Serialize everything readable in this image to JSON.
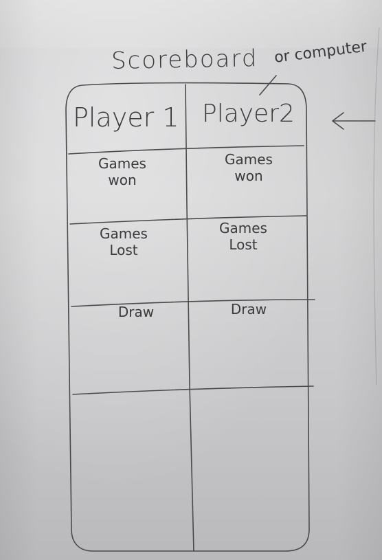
{
  "title": "Scoreboard",
  "alt_label": "or computer",
  "columns": [
    "Player 1",
    "Player2"
  ],
  "rows": [
    {
      "left": [
        "Games",
        "won"
      ],
      "right": [
        "Games",
        "won"
      ]
    },
    {
      "left": [
        "Games",
        "Lost"
      ],
      "right": [
        "Games",
        "Lost"
      ]
    },
    {
      "left": [
        "Draw"
      ],
      "right": [
        "Draw"
      ]
    }
  ],
  "colors": {
    "pencil": "#3a3a3c",
    "paper": "#d2d2d3"
  }
}
